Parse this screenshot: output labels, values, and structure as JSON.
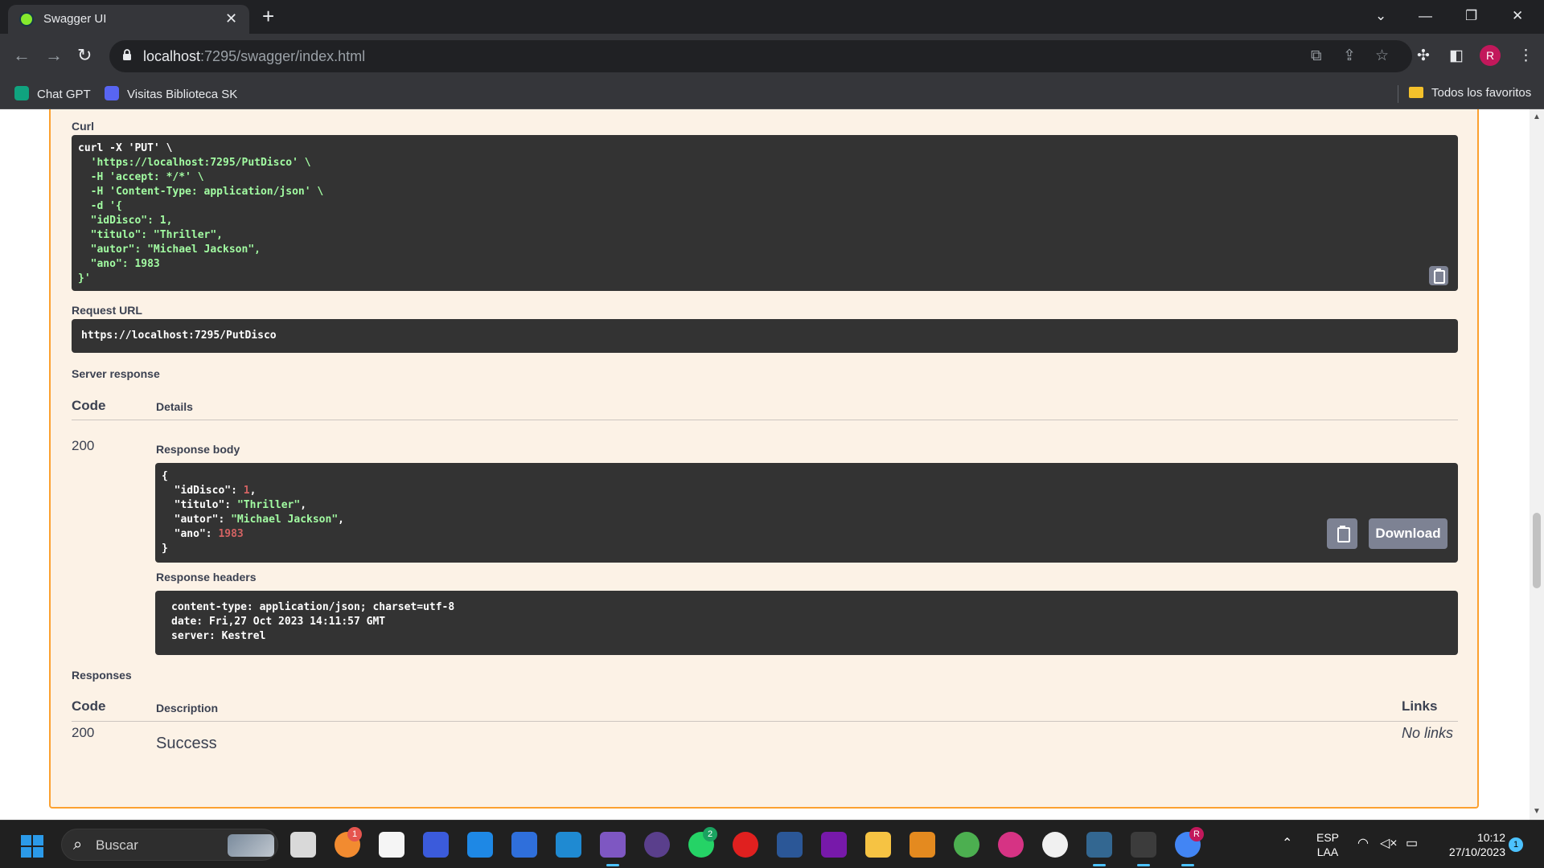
{
  "browser": {
    "tab_title": "Swagger UI",
    "tab_close": "✕",
    "new_tab": "+",
    "url_host": "localhost",
    "url_rest": ":7295/swagger/index.html",
    "profile_initial": "R",
    "bookmarks": [
      {
        "label": "Chat GPT"
      },
      {
        "label": "Visitas Biblioteca SK"
      }
    ],
    "all_bookmarks": "Todos los favoritos"
  },
  "swagger": {
    "curl_label": "Curl",
    "curl_lines": [
      "curl -X 'PUT' \\",
      "  'https://localhost:7295/PutDisco' \\",
      "  -H 'accept: */*' \\",
      "  -H 'Content-Type: application/json' \\",
      "  -d '{",
      "  \"idDisco\": 1,",
      "  \"titulo\": \"Thriller\",",
      "  \"autor\": \"Michael Jackson\",",
      "  \"ano\": 1983",
      "}'"
    ],
    "request_url_label": "Request URL",
    "request_url": "https://localhost:7295/PutDisco",
    "server_response_label": "Server response",
    "code_header": "Code",
    "details_header": "Details",
    "response_code": "200",
    "response_body_label": "Response body",
    "response_body": {
      "open": "{",
      "close": "}",
      "fields": [
        {
          "key": "  \"idDisco\"",
          "value": "1",
          "type": "number",
          "comma": ","
        },
        {
          "key": "  \"titulo\"",
          "value": "\"Thriller\"",
          "type": "string",
          "comma": ","
        },
        {
          "key": "  \"autor\"",
          "value": "\"Michael Jackson\"",
          "type": "string",
          "comma": ","
        },
        {
          "key": "  \"ano\"",
          "value": "1983",
          "type": "number",
          "comma": ""
        }
      ]
    },
    "download_label": "Download",
    "response_headers_label": "Response headers",
    "response_headers": [
      "content-type: application/json; charset=utf-8",
      "date: Fri,27 Oct 2023 14:11:57 GMT",
      "server: Kestrel"
    ],
    "responses_label": "Responses",
    "description_header": "Description",
    "links_header": "Links",
    "responses_code": "200",
    "responses_description": "Success",
    "no_links": "No links"
  },
  "taskbar": {
    "search_placeholder": "Buscar",
    "badge_one": "1",
    "badge_whatsapp": "2",
    "badge_chrome": "R",
    "lang_line1": "ESP",
    "lang_line2": "LAA",
    "time": "10:12",
    "date": "27/10/2023",
    "notification_count": "1"
  },
  "colors": {
    "put_accent": "#fca130",
    "put_background": "#fcf2e6",
    "code_background": "#333333",
    "json_string": "#a2fca2",
    "json_number": "#d36363",
    "button_gray": "#7d8293"
  }
}
